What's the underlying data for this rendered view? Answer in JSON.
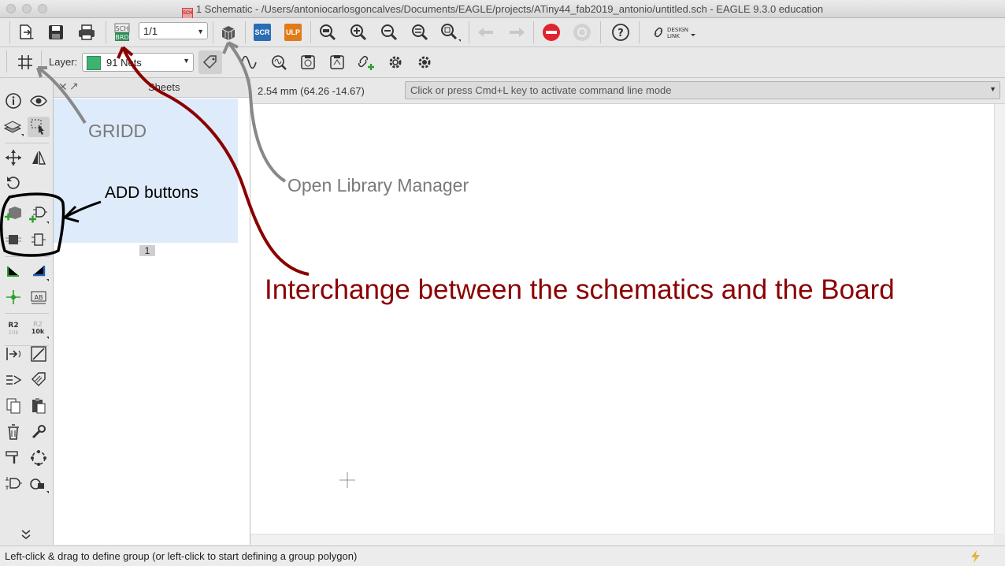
{
  "window": {
    "title": "1 Schematic - /Users/antoniocarlosgoncalves/Documents/EAGLE/projects/ATiny44_fab2019_antonio/untitled.sch - EAGLE 9.3.0 education"
  },
  "toolbar": {
    "sheet_select_value": "1/1",
    "sch_brd_badge_top": "SCH",
    "sch_brd_badge_bottom": "BRD",
    "scr_label": "SCR",
    "ulp_label": "ULP",
    "design_link_line1": "DESIGN",
    "design_link_line2": "LINK",
    "help_label": "?"
  },
  "toolbar2": {
    "layer_label": "Layer:",
    "layer_value": "91 Nets",
    "layer_color": "#3cb371"
  },
  "left_tools": {
    "label_r2": "R2",
    "label_10k": "10k",
    "label_ab": "AB"
  },
  "sheets_panel": {
    "title": "Sheets",
    "sheet_number": "1"
  },
  "coords": {
    "readout": "2.54 mm (64.26 -14.67)"
  },
  "command_line": {
    "placeholder": "Click or press Cmd+L key to activate command line mode"
  },
  "status": {
    "text": "Left-click & drag to define group (or left-click to start defining a group polygon)"
  },
  "annotations": {
    "gridd": "GRIDD",
    "add_buttons": "ADD buttons",
    "open_library_manager": "Open Library Manager",
    "interchange": "Interchange between the schematics and the Board"
  },
  "colors": {
    "annotation_red": "#8b0000",
    "annotation_gray": "#7a7a7a",
    "stop_red": "#e0232c",
    "scr_blue": "#2a6db5",
    "ulp_orange": "#e07b1a",
    "brd_green": "#2e8b57"
  },
  "icons": [
    "new-file-icon",
    "save-icon",
    "print-icon",
    "sch-brd-switch-icon",
    "library-manager-icon",
    "script-icon",
    "ulp-icon",
    "zoom-fit-icon",
    "zoom-in-icon",
    "zoom-out-icon",
    "zoom-previous-icon",
    "zoom-select-icon",
    "undo-icon",
    "redo-icon",
    "stop-icon",
    "go-icon",
    "help-icon",
    "design-link-icon",
    "grid-icon",
    "tag-icon",
    "wave-icon",
    "probe-icon",
    "drc-icon",
    "erc-icon",
    "link-add-icon",
    "settings-icon",
    "settings2-icon",
    "info-icon",
    "eye-icon",
    "layers-icon",
    "group-select-icon",
    "move-icon",
    "mirror-icon",
    "rotate-icon",
    "add-part-icon",
    "add-gate-icon",
    "replace-icon",
    "invoke-icon",
    "wire-icon",
    "net-icon",
    "junction-icon",
    "label-icon",
    "name-icon",
    "value-icon",
    "pinswap-icon",
    "line-icon",
    "gateswap-icon",
    "smash-icon",
    "copy-icon",
    "paste-icon",
    "delete-icon",
    "change-icon",
    "split-icon",
    "miter-icon",
    "attribute-icon",
    "lock-icon",
    "expand-icon",
    "lightning-icon"
  ]
}
